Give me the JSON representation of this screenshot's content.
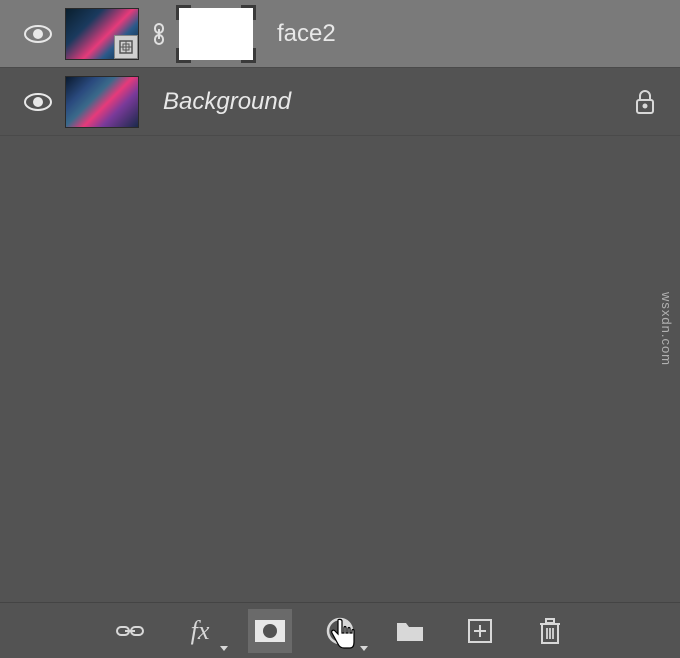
{
  "layers": [
    {
      "name": "face2",
      "visible": true,
      "selected": true,
      "smart_object": true,
      "has_mask": true,
      "locked": false
    },
    {
      "name": "Background",
      "visible": true,
      "selected": false,
      "smart_object": false,
      "has_mask": false,
      "locked": true,
      "italic": true
    }
  ],
  "toolbar": {
    "link": "link-layers",
    "fx": "fx",
    "mask": "add-layer-mask",
    "adjustment": "new-adjustment-layer",
    "group": "new-group",
    "new_layer": "new-layer",
    "delete": "delete-layer"
  },
  "watermark": "wsxdn.com"
}
